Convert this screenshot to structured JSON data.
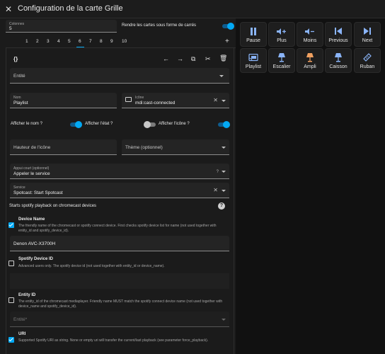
{
  "header": {
    "title": "Configuration de la carte Grille"
  },
  "editor": {
    "colonnes": {
      "label": "Colonnes",
      "value": "5"
    },
    "square_label": "Rendre les cartes sous forme de carrés",
    "square_on": true,
    "tabs": [
      "1",
      "2",
      "3",
      "4",
      "5",
      "6",
      "7",
      "8",
      "9",
      "10"
    ],
    "active_tab": "6",
    "add_tab": "+",
    "toolbar": {
      "code": "{}"
    },
    "entity": {
      "placeholder": "Entité"
    },
    "name": {
      "label": "Nom",
      "value": "Playlist"
    },
    "icon": {
      "label": "Icône",
      "value": "mdi:cast-connected"
    },
    "toggles": [
      {
        "label": "Afficher le nom ?",
        "on": true
      },
      {
        "label": "Afficher l'état ?",
        "on": false
      },
      {
        "label": "Afficher l'icône ?",
        "on": true
      }
    ],
    "icon_height": {
      "placeholder": "Hauteur de l'icône"
    },
    "theme": {
      "placeholder": "Thème (optionnel)"
    },
    "tap_action": {
      "label": "Appui court (optionnel)",
      "value": "Appeler le service"
    },
    "service": {
      "label": "Service",
      "value": "Spotcast: Start Spotcast"
    },
    "service_description": "Starts spotify playback on chromecast devices",
    "params": [
      {
        "checked": true,
        "title": "Device Name",
        "description": "The friendly name of the chromecast or spotify connect device. First checks spotify device list for name (not used together with entity_id and spotify_device_id).",
        "value": "Denon AVC-X3700H"
      },
      {
        "checked": false,
        "title": "Spotify Device ID",
        "description": "Advanced users only. The spotify device id (not used together with entity_id or device_name)."
      },
      {
        "checked": false,
        "title": "Entity ID",
        "description": "The entity_id of the chromecast mediaplayer. Friendly name MUST match the spotify connect device name (not used together with device_name and spotify_device_id).",
        "placeholder": "Entité*"
      },
      {
        "checked": true,
        "title": "URI",
        "description": "Supported Spotify URI as string. None or empty uri will transfer the current/last playback (see parameter force_playback)."
      }
    ]
  },
  "grid": {
    "cards": [
      {
        "label": "Pause",
        "icon": "pause-icon",
        "color": "#8ab4f8"
      },
      {
        "label": "Plus",
        "icon": "volume-plus-icon",
        "color": "#8ab4f8"
      },
      {
        "label": "Moins",
        "icon": "volume-minus-icon",
        "color": "#8ab4f8"
      },
      {
        "label": "Previous",
        "icon": "skip-previous-icon",
        "color": "#8ab4f8"
      },
      {
        "label": "Next",
        "icon": "skip-next-icon",
        "color": "#8ab4f8"
      },
      {
        "label": "Playlist",
        "icon": "cast-connected-icon",
        "color": "#8ab4f8"
      },
      {
        "label": "Escalier",
        "icon": "floor-lamp-icon",
        "color": "#8ab4f8"
      },
      {
        "label": "Ampli",
        "icon": "lamp-on-icon",
        "color": "#f0a060"
      },
      {
        "label": "Caisson",
        "icon": "floor-lamp-icon",
        "color": "#8ab4f8"
      },
      {
        "label": "Ruban",
        "icon": "led-strip-icon",
        "color": "#8ab4f8"
      }
    ]
  },
  "colors": {
    "accent": "#03a9f4",
    "background": "#111111",
    "surface": "#1b1b1b"
  }
}
